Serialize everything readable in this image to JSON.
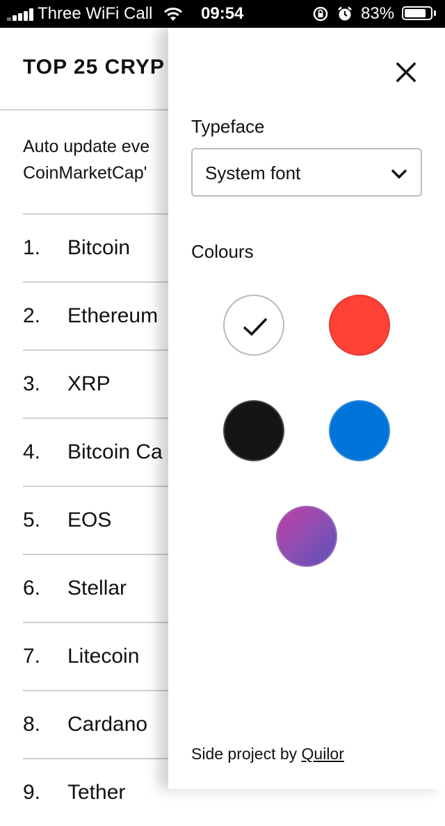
{
  "status_bar": {
    "carrier": "Three WiFi Call",
    "time": "09:54",
    "battery_percent": "83%",
    "battery_level": 0.83
  },
  "main": {
    "title": "TOP 25 CRYP",
    "intro_line1": "Auto update eve",
    "intro_line2": "CoinMarketCap'",
    "coins": [
      {
        "rank": "1.",
        "name": "Bitcoin"
      },
      {
        "rank": "2.",
        "name": "Ethereum"
      },
      {
        "rank": "3.",
        "name": "XRP"
      },
      {
        "rank": "4.",
        "name": "Bitcoin Ca"
      },
      {
        "rank": "5.",
        "name": "EOS"
      },
      {
        "rank": "6.",
        "name": "Stellar"
      },
      {
        "rank": "7.",
        "name": "Litecoin"
      },
      {
        "rank": "8.",
        "name": "Cardano"
      },
      {
        "rank": "9.",
        "name": "Tether"
      }
    ]
  },
  "drawer": {
    "typeface_label": "Typeface",
    "typeface_value": "System font",
    "colours_label": "Colours",
    "colours": [
      {
        "name": "white",
        "hex": "#ffffff",
        "selected": true
      },
      {
        "name": "red",
        "hex": "#ff4136",
        "selected": false
      },
      {
        "name": "black",
        "hex": "#151515",
        "selected": false
      },
      {
        "name": "blue",
        "hex": "#0074d9",
        "selected": false
      },
      {
        "name": "purple-gradient",
        "hex": "#8e4fb3",
        "selected": false
      }
    ],
    "footer_text": "Side project by ",
    "footer_link": "Quilor"
  },
  "icons": {
    "close": "close-icon",
    "chevron": "chevron-down-icon",
    "check": "checkmark-icon"
  }
}
